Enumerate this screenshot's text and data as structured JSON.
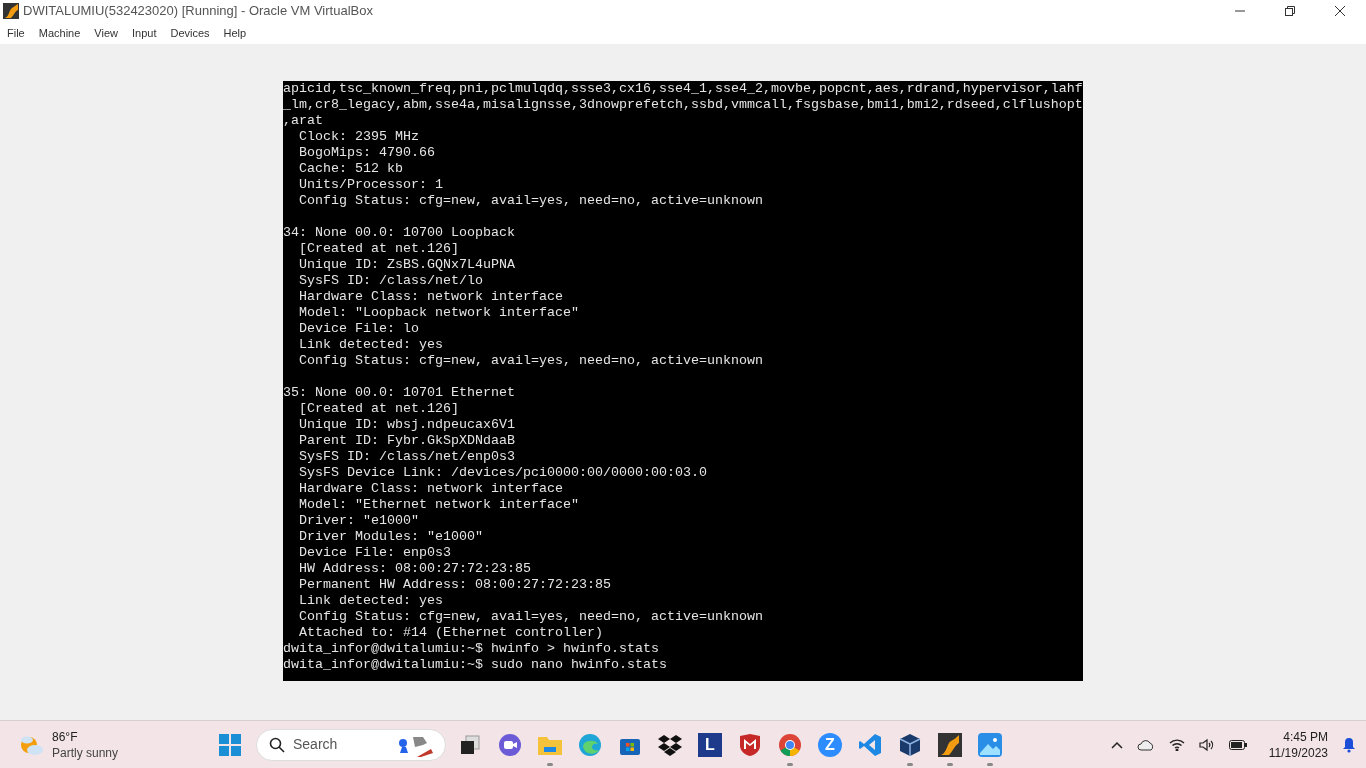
{
  "window": {
    "title": "DWITALUMIU(532423020) [Running] - Oracle VM VirtualBox"
  },
  "menu": [
    "File",
    "Machine",
    "View",
    "Input",
    "Devices",
    "Help"
  ],
  "terminal": {
    "blocks": [
      [
        "apicid,tsc_known_freq,pni,pclmulqdq,ssse3,cx16,sse4_1,sse4_2,movbe,popcnt,aes,rdrand,hypervisor,lahf",
        "_lm,cr8_legacy,abm,sse4a,misalignsse,3dnowprefetch,ssbd,vmmcall,fsgsbase,bmi1,bmi2,rdseed,clflushopt",
        ",arat",
        "  Clock: 2395 MHz",
        "  BogoMips: 4790.66",
        "  Cache: 512 kb",
        "  Units/Processor: 1",
        "  Config Status: cfg=new, avail=yes, need=no, active=unknown"
      ],
      [
        "34: None 00.0: 10700 Loopback",
        "  [Created at net.126]",
        "  Unique ID: ZsBS.GQNx7L4uPNA",
        "  SysFS ID: /class/net/lo",
        "  Hardware Class: network interface",
        "  Model: \"Loopback network interface\"",
        "  Device File: lo",
        "  Link detected: yes",
        "  Config Status: cfg=new, avail=yes, need=no, active=unknown"
      ],
      [
        "35: None 00.0: 10701 Ethernet",
        "  [Created at net.126]",
        "  Unique ID: wbsj.ndpeucax6V1",
        "  Parent ID: Fybr.GkSpXDNdaaB",
        "  SysFS ID: /class/net/enp0s3",
        "  SysFS Device Link: /devices/pci0000:00/0000:00:03.0",
        "  Hardware Class: network interface",
        "  Model: \"Ethernet network interface\"",
        "  Driver: \"e1000\"",
        "  Driver Modules: \"e1000\"",
        "  Device File: enp0s3",
        "  HW Address: 08:00:27:72:23:85",
        "  Permanent HW Address: 08:00:27:72:23:85",
        "  Link detected: yes",
        "  Config Status: cfg=new, avail=yes, need=no, active=unknown",
        "  Attached to: #14 (Ethernet controller)",
        "dwita_infor@dwitalumiu:~$ hwinfo > hwinfo.stats",
        "dwita_infor@dwitalumiu:~$ sudo nano hwinfo.stats"
      ]
    ]
  },
  "taskbar": {
    "weather": {
      "temperature": "86°F",
      "condition": "Partly sunny"
    },
    "search": {
      "placeholder": "Search"
    },
    "apps": [
      {
        "kind": "taskview",
        "running": false
      },
      {
        "kind": "chat",
        "running": false
      },
      {
        "kind": "folder",
        "running": true
      },
      {
        "kind": "browser-wave",
        "running": false
      },
      {
        "kind": "store",
        "running": false
      },
      {
        "kind": "dropbox",
        "running": false
      },
      {
        "kind": "letter",
        "label": "L",
        "running": false
      },
      {
        "kind": "shield",
        "running": false
      },
      {
        "kind": "chrome",
        "running": true
      },
      {
        "kind": "zoom",
        "label": "Z",
        "running": false
      },
      {
        "kind": "code",
        "running": false
      },
      {
        "kind": "cube",
        "running": true
      },
      {
        "kind": "vm",
        "running": true
      },
      {
        "kind": "photos",
        "running": true
      }
    ],
    "time": "4:45 PM",
    "date": "11/19/2023"
  }
}
